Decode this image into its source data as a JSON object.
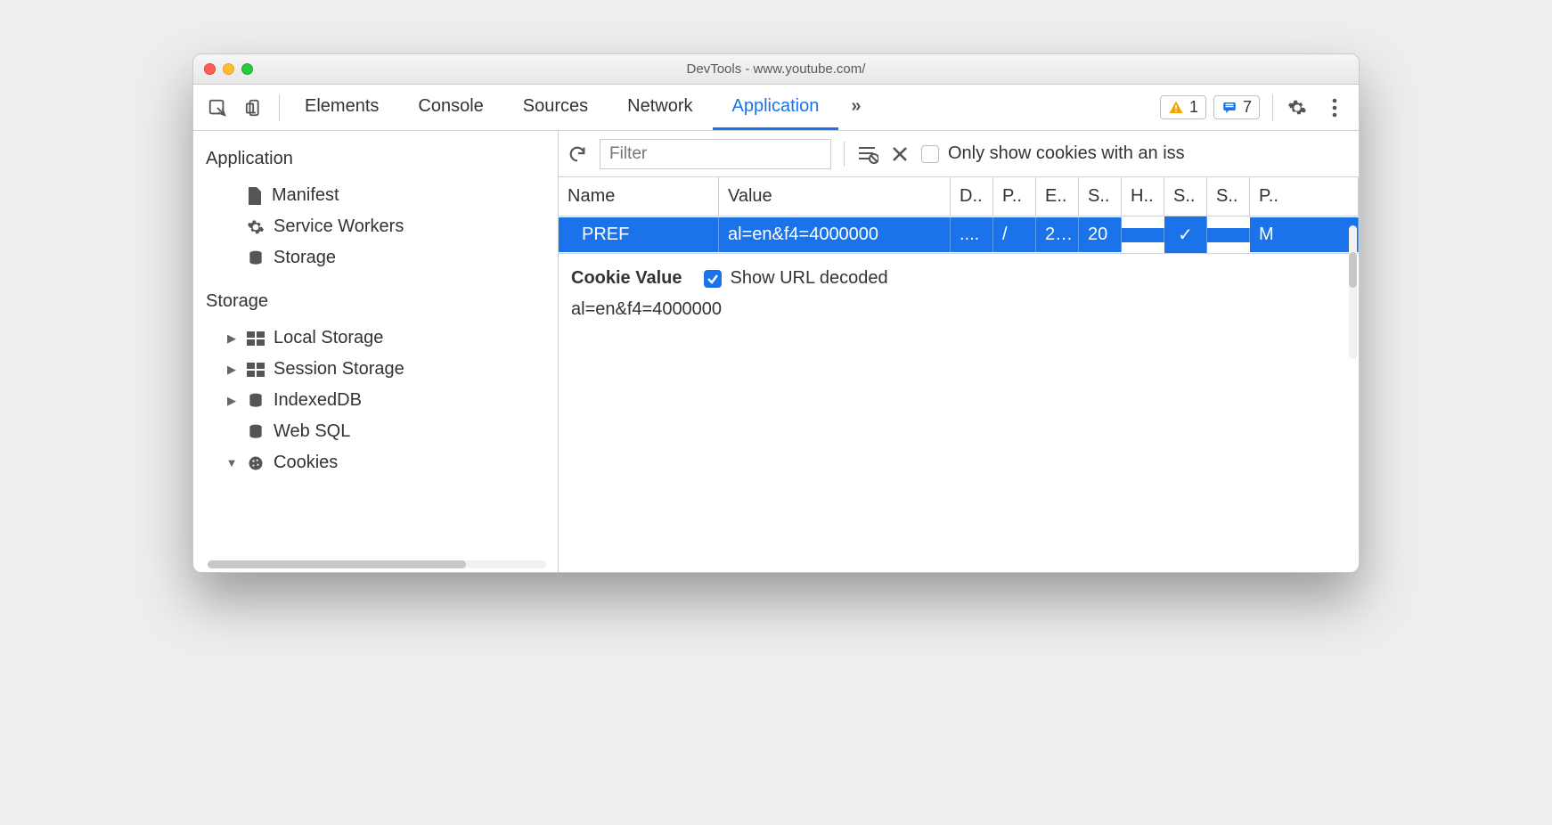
{
  "window": {
    "title": "DevTools - www.youtube.com/"
  },
  "toolbar": {
    "tabs": [
      "Elements",
      "Console",
      "Sources",
      "Network",
      "Application"
    ],
    "active_tab": "Application",
    "more_glyph": "»",
    "warnings_count": "1",
    "messages_count": "7"
  },
  "sidebar": {
    "groups": [
      {
        "title": "Application",
        "items": [
          {
            "label": "Manifest",
            "icon": "file",
            "expandable": false
          },
          {
            "label": "Service Workers",
            "icon": "gear",
            "expandable": false
          },
          {
            "label": "Storage",
            "icon": "db",
            "expandable": false
          }
        ]
      },
      {
        "title": "Storage",
        "items": [
          {
            "label": "Local Storage",
            "icon": "grid",
            "expandable": true,
            "arrow": "▶"
          },
          {
            "label": "Session Storage",
            "icon": "grid",
            "expandable": true,
            "arrow": "▶"
          },
          {
            "label": "IndexedDB",
            "icon": "db",
            "expandable": true,
            "arrow": "▶"
          },
          {
            "label": "Web SQL",
            "icon": "db",
            "expandable": false,
            "arrow": ""
          },
          {
            "label": "Cookies",
            "icon": "cookie",
            "expandable": true,
            "arrow": "▼"
          }
        ]
      }
    ]
  },
  "actionbar": {
    "filter_placeholder": "Filter",
    "only_issues_label": "Only show cookies with an iss"
  },
  "table": {
    "headers": [
      "Name",
      "Value",
      "D..",
      "P..",
      "E..",
      "S..",
      "H..",
      "S..",
      "S..",
      "P.."
    ],
    "rows": [
      {
        "name": "PREF",
        "value": "al=en&f4=4000000",
        "cells": [
          "....",
          "/",
          "2…",
          "20",
          "",
          "✓",
          "",
          "M"
        ]
      }
    ]
  },
  "detail": {
    "label": "Cookie Value",
    "show_decoded_label": "Show URL decoded",
    "show_decoded_checked": true,
    "value": "al=en&f4=4000000"
  }
}
